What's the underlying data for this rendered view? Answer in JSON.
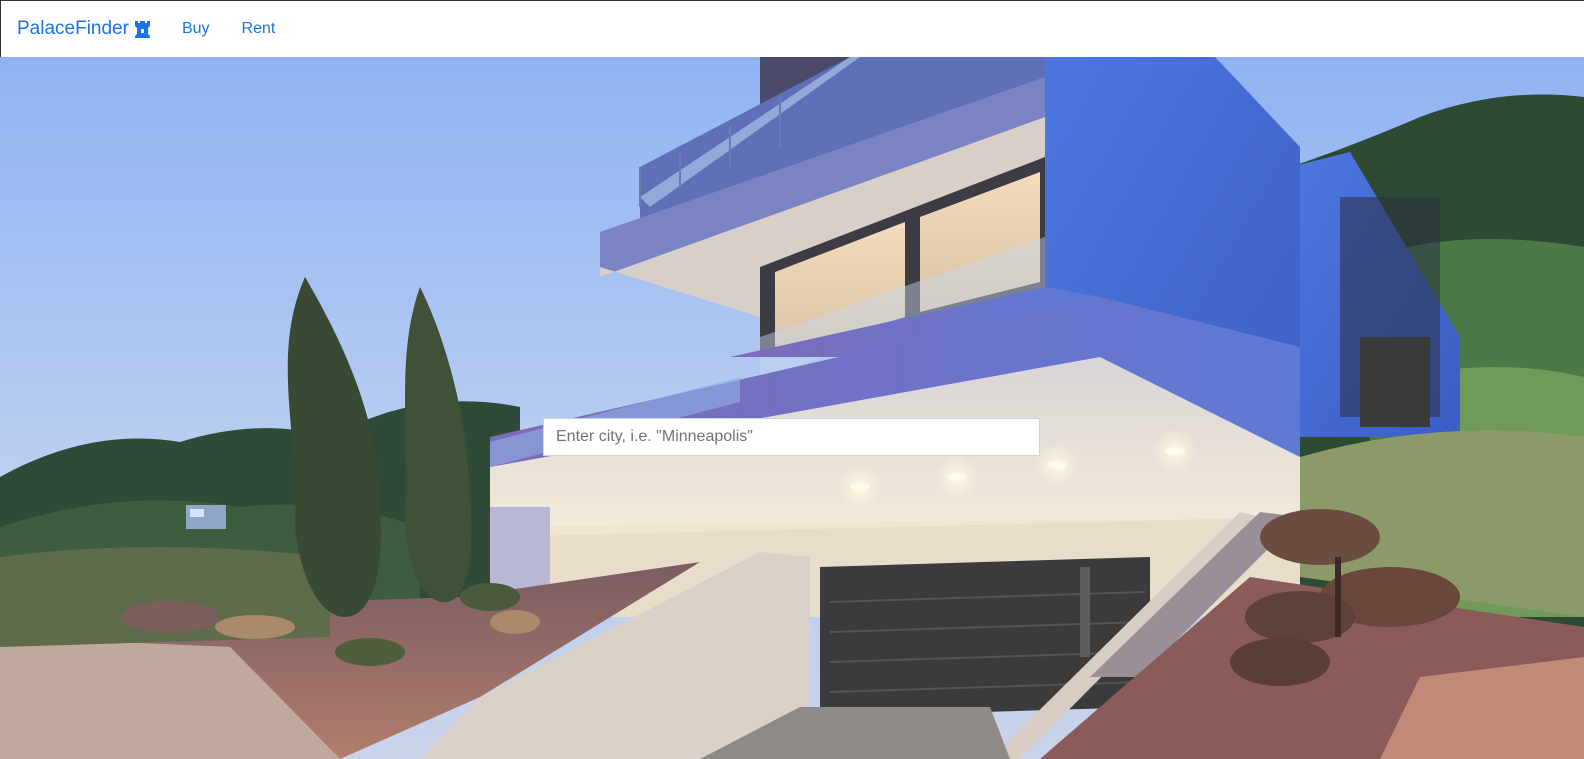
{
  "navbar": {
    "brand_label": "PalaceFinder",
    "brand_icon": "castle-rook-icon",
    "links": [
      {
        "label": "Buy"
      },
      {
        "label": "Rent"
      }
    ]
  },
  "hero": {
    "image": "modern-house-at-dusk",
    "search": {
      "placeholder": "Enter city, i.e. \"Minneapolis\"",
      "value": ""
    }
  },
  "colors": {
    "accent": "#1a73e8",
    "navbar_bg": "#ffffff"
  }
}
